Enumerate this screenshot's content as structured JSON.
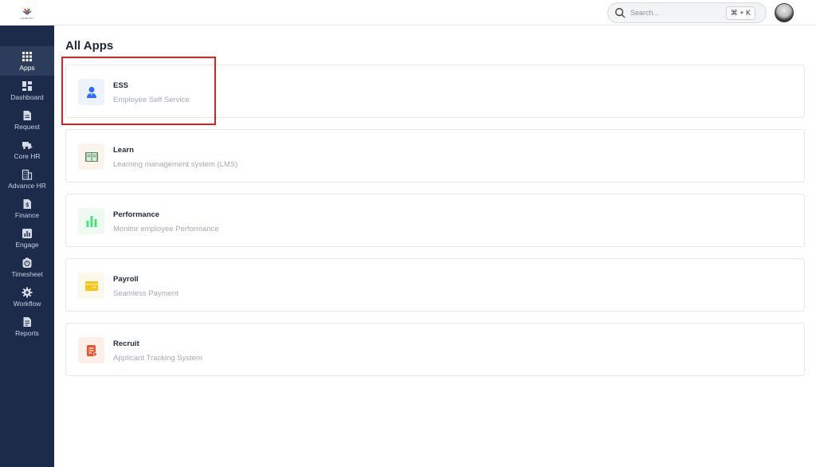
{
  "brand": {
    "logo_text": "COMPANY"
  },
  "search": {
    "placeholder": "Search...",
    "shortcut": "⌘ + K"
  },
  "sidebar": {
    "items": [
      {
        "label": "Apps",
        "icon": "grid-icon",
        "active": true
      },
      {
        "label": "Dashboard",
        "icon": "dashboard-icon"
      },
      {
        "label": "Request",
        "icon": "document-icon"
      },
      {
        "label": "Core HR",
        "icon": "truck-icon"
      },
      {
        "label": "Advance HR",
        "icon": "building-icon"
      },
      {
        "label": "Finance",
        "icon": "dollar-icon"
      },
      {
        "label": "Engage",
        "icon": "bar-chart-icon"
      },
      {
        "label": "Timesheet",
        "icon": "clock-icon"
      },
      {
        "label": "Workflow",
        "icon": "gear-icon"
      },
      {
        "label": "Reports",
        "icon": "report-icon"
      }
    ]
  },
  "main": {
    "title": "All Apps",
    "apps": [
      {
        "title": "ESS",
        "subtitle": "Employee Self Service",
        "icon": "user-icon",
        "color": "#2f6bff",
        "bg": "#eef2fb"
      },
      {
        "title": "Learn",
        "subtitle": "Learning management system (LMS)",
        "icon": "book-icon",
        "color": "#4f8a5b",
        "bg": "#fbf3ec"
      },
      {
        "title": "Performance",
        "subtitle": "Monitor employee Performance",
        "icon": "bar-chart-icon",
        "color": "#4ade80",
        "bg": "#eefaf1"
      },
      {
        "title": "Payroll",
        "subtitle": "Seamless Payment",
        "icon": "wallet-icon",
        "color": "#f5c518",
        "bg": "#fdf8ec"
      },
      {
        "title": "Recruit",
        "subtitle": "Applicant Tracking System",
        "icon": "applicant-icon",
        "color": "#e2572f",
        "bg": "#fcefe9"
      }
    ]
  },
  "colors": {
    "sidebar_bg": "#1c2b4a",
    "sidebar_active": "#2c3c5c",
    "highlight": "#e02020"
  }
}
